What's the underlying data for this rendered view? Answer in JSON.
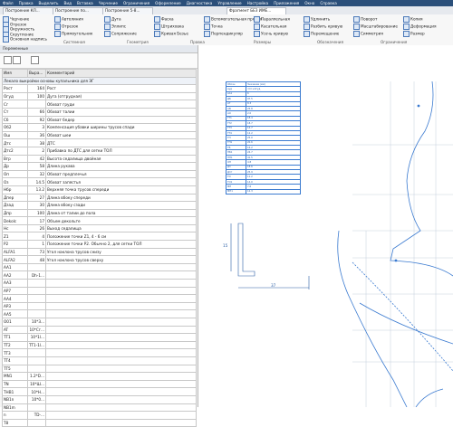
{
  "menubar": [
    "Файл",
    "Правка",
    "Выделить",
    "Вид",
    "Вставка",
    "Черчение",
    "Ограничения",
    "Оформление",
    "Диагностика",
    "Управление",
    "Настройка",
    "Приложения",
    "Окно",
    "Справка"
  ],
  "tabs": [
    {
      "label": "Построение КЛ..."
    },
    {
      "label": "Построение по..."
    },
    {
      "label": "Построение 5-8..."
    },
    {
      "label": "Фрагмент БЕЗ ИМЕ..."
    }
  ],
  "ribbon": {
    "left": [
      "Черчение",
      "Отрезок",
      "Окружность",
      "Скругление",
      "Основная надпись"
    ],
    "items": [
      "Автолиния",
      "Отрезок",
      "Прямоугольник",
      "Дуга",
      "Эллипс",
      "Сопряжение",
      "Фаска",
      "Штриховка",
      "Кривая Безье",
      "Вспомогательная прямая",
      "Точка",
      "Перпендикуляр",
      "Параллельная",
      "Касательная",
      "Усечь кривую",
      "Удлинить",
      "Разбить кривую",
      "Перемещение",
      "Поворот",
      "Масштабирование",
      "Симметрия",
      "Копия",
      "Деформация",
      "Размер"
    ],
    "groups": [
      "Системная",
      "Геометрия",
      "Правка",
      "Размеры",
      "Обозначения",
      "Ограничения"
    ]
  },
  "panel": {
    "title": "Переменные",
    "columns": [
      "Имя",
      "Выра...",
      "Комментарий"
    ],
    "group_title": "Лекало выкройки основы купальника для ЭГ",
    "rows": [
      {
        "name": "Рост",
        "value": "164",
        "comment": "Рост"
      },
      {
        "name": "Огуд",
        "value": "100",
        "comment": "Дуга (отгрудная)"
      },
      {
        "name": "Сг",
        "value": "",
        "comment": "Обхват груди"
      },
      {
        "name": "Ст",
        "value": "66",
        "comment": "Обхват талии"
      },
      {
        "name": "Сб",
        "value": "92",
        "comment": "Обхват бедер"
      },
      {
        "name": "Об2",
        "value": "3",
        "comment": "Компенсация убавки ширины трусов спади"
      },
      {
        "name": "Ош",
        "value": "36",
        "comment": "Обхват шеи"
      },
      {
        "name": "Дтс",
        "value": "38",
        "comment": "ДТС"
      },
      {
        "name": "Дтс2",
        "value": "2",
        "comment": "Прибавка по ДТС для сетки ТОЛ"
      },
      {
        "name": "Вгр",
        "value": "42",
        "comment": "Высота седалища двойная"
      },
      {
        "name": "Др",
        "value": "58",
        "comment": "Длина рукава"
      },
      {
        "name": "Оп",
        "value": "32",
        "comment": "Обхват предплечья"
      },
      {
        "name": "Оз",
        "value": "14.5",
        "comment": "Обхват запястья"
      },
      {
        "name": "Нбр",
        "value": "13.2",
        "comment": "Верхняя точка трусов спереди"
      },
      {
        "name": "Дпер",
        "value": "27",
        "comment": "Длина вбоку спереди"
      },
      {
        "name": "Дзад",
        "value": "30",
        "comment": "Длина вбоку сзади"
      },
      {
        "name": "Дпр",
        "value": "100",
        "comment": "Длина от талии до пола"
      },
      {
        "name": "Dekolc",
        "value": "17",
        "comment": "Объем декольте"
      },
      {
        "name": "Нс",
        "value": "26",
        "comment": "Выход седалища"
      },
      {
        "name": "Z1",
        "value": "4",
        "comment": "Положение точки Z1, 4 - 6 см"
      },
      {
        "name": "P2",
        "value": "1",
        "comment": "Положение точки Р2. Обычно 2, для сетки ТОЛ"
      },
      {
        "name": "ALFA1",
        "value": "73",
        "comment": "Угол наклона трусов снизу"
      },
      {
        "name": "ALFA2",
        "value": "48",
        "comment": "Угол наклона трусов сверху"
      },
      {
        "name": "AA1",
        "value": "",
        "comment": ""
      },
      {
        "name": "AA2",
        "value": "Dh-1...",
        "comment": ""
      },
      {
        "name": "AA3",
        "value": "",
        "comment": ""
      },
      {
        "name": "AP7",
        "value": "",
        "comment": ""
      },
      {
        "name": "AA4",
        "value": "",
        "comment": ""
      },
      {
        "name": "AP3",
        "value": "",
        "comment": ""
      },
      {
        "name": "AA5",
        "value": "",
        "comment": ""
      },
      {
        "name": "O01",
        "value": "10*3...",
        "comment": ""
      },
      {
        "name": "AT",
        "value": "10*Сг...",
        "comment": ""
      },
      {
        "name": "TT1",
        "value": "10*1l...",
        "comment": ""
      },
      {
        "name": "TT2",
        "value": "TT1-1l...",
        "comment": ""
      },
      {
        "name": "TT3",
        "value": "",
        "comment": ""
      },
      {
        "name": "TT4",
        "value": "",
        "comment": ""
      },
      {
        "name": "TT5",
        "value": "",
        "comment": ""
      },
      {
        "name": "MN1",
        "value": "1.2*D...",
        "comment": ""
      },
      {
        "name": "TN",
        "value": "10*Ш...",
        "comment": ""
      },
      {
        "name": "THB1",
        "value": "10*H...",
        "comment": ""
      },
      {
        "name": "NB1n",
        "value": "10*0...",
        "comment": ""
      },
      {
        "name": "NB1m",
        "value": "",
        "comment": ""
      },
      {
        "name": "n",
        "value": "TD-...",
        "comment": ""
      },
      {
        "name": "T8",
        "value": "",
        "comment": ""
      }
    ]
  },
  "measure_table": [
    [
      "Обозн.",
      "Значение (мм)"
    ],
    [
      "Ауд",
      "=Сг+Огуд"
    ],
    [
      "АА1",
      "6"
    ],
    [
      "ДБ",
      "97.5"
    ],
    [
      "АТ",
      "8.3"
    ],
    [
      "АN",
      "25.8"
    ],
    [
      "АО",
      "2.0"
    ],
    [
      "ТТ1",
      "18.4"
    ],
    [
      "ТТ2",
      "18.7"
    ],
    [
      "ТТ3",
      "14.7"
    ],
    [
      "ТТ4",
      "12.2"
    ],
    [
      "ТН",
      "25.0"
    ],
    [
      "ТН1",
      "20.6"
    ],
    [
      "ТБ",
      "16.2"
    ],
    [
      "НБ1",
      "24.7"
    ],
    [
      "НН1",
      "41.5"
    ],
    [
      "ОН",
      "4.8"
    ],
    [
      "Дп",
      "18.6"
    ],
    [
      "Дпт",
      "25.9"
    ],
    [
      "ТО",
      "11.2"
    ],
    [
      "ТО1",
      "14.0"
    ],
    [
      "МН",
      "7.6"
    ],
    [
      "МН1",
      "12.3"
    ]
  ],
  "canvas": {
    "dim_h": "15",
    "dim_w": "37"
  },
  "colors": {
    "accent": "#2b4f7a",
    "line": "#3a7ad0"
  }
}
